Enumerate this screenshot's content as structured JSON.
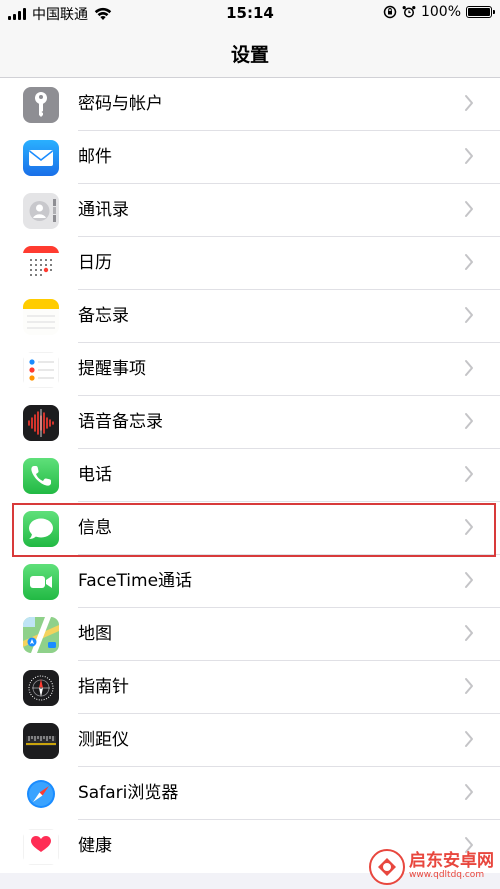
{
  "status_bar": {
    "carrier": "中国联通",
    "time": "15:14",
    "battery": "100%",
    "icons": [
      "signal-icon",
      "wifi-icon",
      "orientation-lock-icon",
      "alarm-icon",
      "battery-icon"
    ]
  },
  "nav": {
    "title": "设置"
  },
  "settings_items": [
    {
      "label": "密码与帐户",
      "icon": "key-icon",
      "color": "#8e8e93"
    },
    {
      "label": "邮件",
      "icon": "mail-icon",
      "color": "#1a8cff"
    },
    {
      "label": "通讯录",
      "icon": "contacts-icon",
      "color": "#d6d6d6"
    },
    {
      "label": "日历",
      "icon": "calendar-icon",
      "color": "#ffffff"
    },
    {
      "label": "备忘录",
      "icon": "notes-icon",
      "color": "#ffcc00"
    },
    {
      "label": "提醒事项",
      "icon": "reminders-icon",
      "color": "#ffffff"
    },
    {
      "label": "语音备忘录",
      "icon": "voice-memos-icon",
      "color": "#1c1c1e"
    },
    {
      "label": "电话",
      "icon": "phone-icon",
      "color": "#34c759"
    },
    {
      "label": "信息",
      "icon": "messages-icon",
      "color": "#34c759"
    },
    {
      "label": "FaceTime通话",
      "icon": "facetime-icon",
      "color": "#34c759"
    },
    {
      "label": "地图",
      "icon": "maps-icon",
      "color": "#7fc27e"
    },
    {
      "label": "指南针",
      "icon": "compass-icon",
      "color": "#1c1c1e"
    },
    {
      "label": "测距仪",
      "icon": "measure-icon",
      "color": "#1c1c1e"
    },
    {
      "label": "Safari浏览器",
      "icon": "safari-icon",
      "color": "#ffffff"
    },
    {
      "label": "健康",
      "icon": "health-icon",
      "color": "#ffffff"
    }
  ],
  "highlighted_item": "信息",
  "highlight_color": "#d83a3a",
  "watermark": {
    "title": "启东安卓网",
    "url": "www.qdltdq.com",
    "color": "#e8473e"
  }
}
